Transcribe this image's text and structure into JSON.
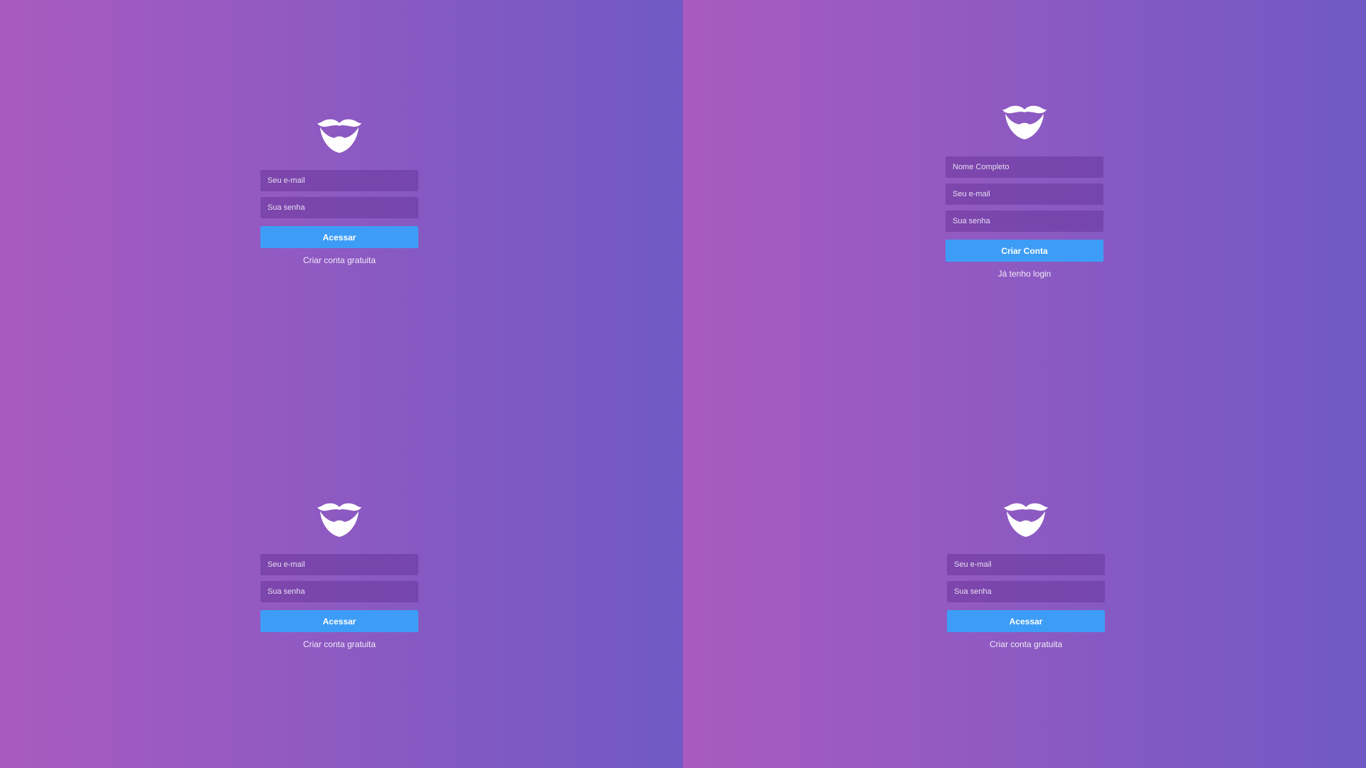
{
  "colors": {
    "gradient_start": "#a95ac0",
    "gradient_end": "#7059c4",
    "field_bg": "#7d4aa9",
    "button_bg": "#3d9df6",
    "text": "#ffffff"
  },
  "panels": {
    "top_left": {
      "logo_icon": "mustache-goatee-icon",
      "email_placeholder": "Seu e-mail",
      "password_placeholder": "Sua senha",
      "submit_label": "Acessar",
      "link_label": "Criar conta gratuita"
    },
    "top_right": {
      "logo_icon": "mustache-goatee-icon",
      "name_placeholder": "Nome Completo",
      "email_placeholder": "Seu e-mail",
      "password_placeholder": "Sua senha",
      "submit_label": "Criar Conta",
      "link_label": "Já tenho login"
    },
    "bottom_left": {
      "logo_icon": "mustache-goatee-icon",
      "email_placeholder": "Seu e-mail",
      "password_placeholder": "Sua senha",
      "submit_label": "Acessar",
      "link_label": "Criar conta gratuita"
    },
    "bottom_right": {
      "logo_icon": "mustache-goatee-icon",
      "email_placeholder": "Seu e-mail",
      "password_placeholder": "Sua senha",
      "submit_label": "Acessar",
      "link_label": "Criar conta gratuita"
    }
  }
}
